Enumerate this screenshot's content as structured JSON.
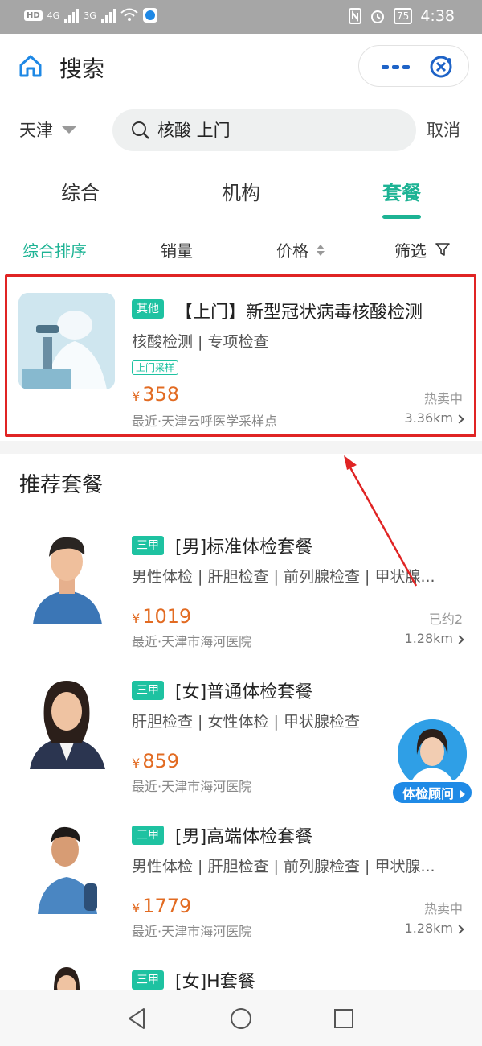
{
  "status_bar": {
    "network_chip": "HD",
    "net_label_1": "4G",
    "net_label_2": "3G",
    "battery": "75",
    "time": "4:38"
  },
  "header": {
    "title": "搜索"
  },
  "search": {
    "city": "天津",
    "query": "核酸 上门",
    "cancel_label": "取消"
  },
  "tabs": [
    {
      "label": "综合",
      "active": false
    },
    {
      "label": "机构",
      "active": false
    },
    {
      "label": "套餐",
      "active": true
    }
  ],
  "filters": {
    "sort": "综合排序",
    "sales": "销量",
    "price": "价格",
    "filter": "筛选"
  },
  "top_result": {
    "badge": "其他",
    "title": "【上门】新型冠状病毒核酸检测",
    "tags": "核酸检测 | 专项检查",
    "outline_tag": "上门采样",
    "currency": "¥",
    "price": "358",
    "status": "热卖中",
    "location": "最近·天津云呼医学采样点",
    "distance": "3.36km"
  },
  "recommend": {
    "title": "推荐套餐",
    "items": [
      {
        "badge": "三甲",
        "title": "[男]标准体检套餐",
        "tags": "男性体检 | 肝胆检查 | 前列腺检查 | 甲状腺...",
        "currency": "¥",
        "price": "1019",
        "status": "已约2",
        "location": "最近·天津市海河医院",
        "distance": "1.28km"
      },
      {
        "badge": "三甲",
        "title": "[女]普通体检套餐",
        "tags": "肝胆检查 | 女性体检 | 甲状腺检查",
        "currency": "¥",
        "price": "859",
        "status": "",
        "location": "最近·天津市海河医院",
        "distance": ""
      },
      {
        "badge": "三甲",
        "title": "[男]高端体检套餐",
        "tags": "男性体检 | 肝胆检查 | 前列腺检查 | 甲状腺...",
        "currency": "¥",
        "price": "1779",
        "status": "热卖中",
        "location": "最近·天津市海河医院",
        "distance": "1.28km"
      },
      {
        "badge": "三甲",
        "title": "[女]H套餐"
      }
    ]
  },
  "advisor": {
    "label": "体检顾问"
  },
  "colors": {
    "accent": "#1db394",
    "price": "#e26b22",
    "highlight": "#e02424"
  }
}
